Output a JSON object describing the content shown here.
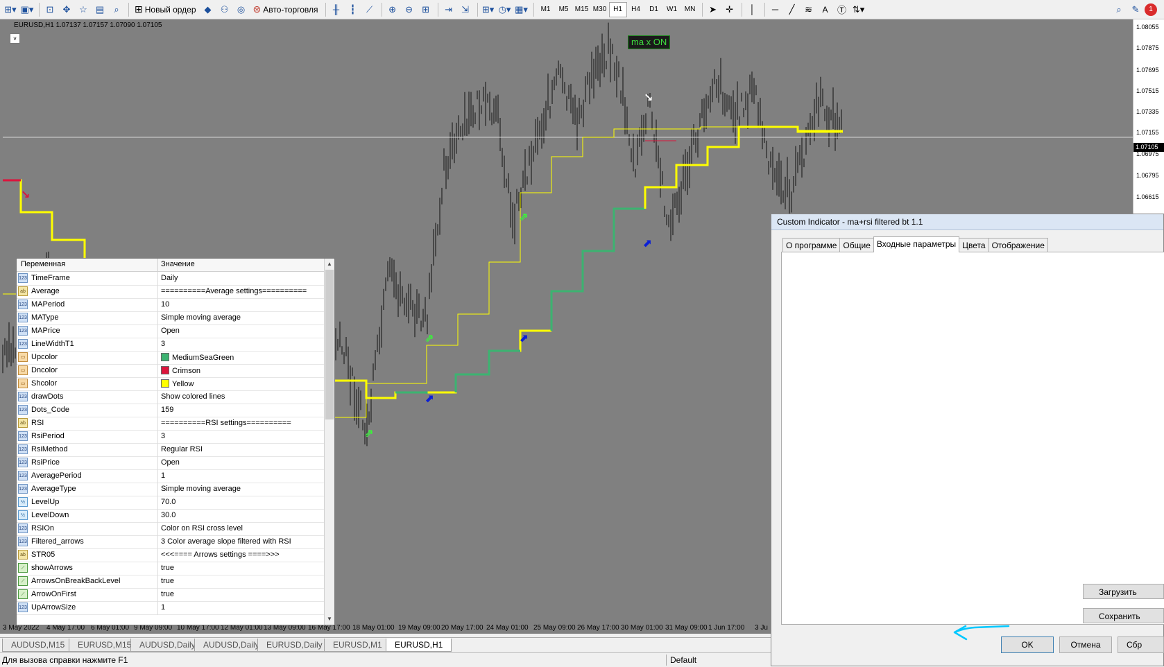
{
  "toolbar": {
    "new_order": "Новый ордер",
    "autotrading": "Авто-торговля",
    "timeframes": [
      "M1",
      "M5",
      "M15",
      "M30",
      "H1",
      "H4",
      "D1",
      "W1",
      "MN"
    ],
    "active_timeframe": "H1",
    "text_tool": "A",
    "notif_count": "1"
  },
  "chart": {
    "header": "EURUSD,H1  1.07137 1.07157 1.07090 1.07105",
    "menu_glyph": "v",
    "badge": "ma x ON",
    "price_ticks": [
      "1.08055",
      "1.07875",
      "1.07695",
      "1.07515",
      "1.07335",
      "1.07155",
      "1.06975",
      "1.06795",
      "1.06615"
    ],
    "last_price": "1.07105",
    "dates": [
      "3 May 2022",
      "4 May 17:00",
      "6 May 01:00",
      "9 May 09:00",
      "10 May 17:00",
      "12 May 01:00",
      "13 May 09:00",
      "16 May 17:00",
      "18 May 01:00",
      "19 May 09:00",
      "20 May 17:00",
      "24 May 01:00",
      "25 May 09:00",
      "26 May 17:00",
      "30 May 01:00",
      "31 May 09:00",
      "1 Jun 17:00",
      "3 Ju"
    ]
  },
  "chart_tabs": [
    "AUDUSD,M15",
    "EURUSD,M15",
    "AUDUSD,Daily",
    "AUDUSD,Daily",
    "EURUSD,Daily",
    "EURUSD,M1",
    "EURUSD,H1"
  ],
  "active_chart_tab": "EURUSD,H1",
  "status": {
    "help": "Для вызова справки нажмите F1",
    "profile": "Default"
  },
  "dialog": {
    "title": "Custom Indicator - ma+rsi filtered bt 1.1",
    "tabs": [
      "О программе",
      "Общие",
      "Входные параметры",
      "Цвета",
      "Отображение"
    ],
    "active_tab": "Входные параметры",
    "col_variable": "Переменная",
    "col_value": "Значение",
    "params": [
      {
        "icon": "123",
        "name": "TimeFrame",
        "value": "Daily"
      },
      {
        "icon": "ab",
        "name": "Average",
        "value": "==========Average settings=========="
      },
      {
        "icon": "123",
        "name": "MAPeriod",
        "value": "10"
      },
      {
        "icon": "123",
        "name": "MAType",
        "value": "Simple moving average"
      },
      {
        "icon": "123",
        "name": "MAPrice",
        "value": "Open"
      },
      {
        "icon": "123",
        "name": "LineWidthT1",
        "value": "3"
      },
      {
        "icon": "cl",
        "name": "Upcolor",
        "value": "MediumSeaGreen",
        "swatch": "#3cb371"
      },
      {
        "icon": "cl",
        "name": "Dncolor",
        "value": "Crimson",
        "swatch": "#dc143c"
      },
      {
        "icon": "cl",
        "name": "Shcolor",
        "value": "Yellow",
        "swatch": "#ffff00"
      },
      {
        "icon": "123",
        "name": "drawDots",
        "value": "Show colored lines"
      },
      {
        "icon": "123",
        "name": "Dots_Code",
        "value": "159"
      },
      {
        "icon": "ab",
        "name": "RSI",
        "value": "==========RSI settings=========="
      },
      {
        "icon": "123",
        "name": "RsiPeriod",
        "value": "3"
      },
      {
        "icon": "123",
        "name": "RsiMethod",
        "value": "Regular RSI"
      },
      {
        "icon": "123",
        "name": "RsiPrice",
        "value": "Open"
      },
      {
        "icon": "123",
        "name": "AveragePeriod",
        "value": "1"
      },
      {
        "icon": "123",
        "name": "AverageType",
        "value": "Simple moving average"
      },
      {
        "icon": "db",
        "name": "LevelUp",
        "value": "70.0"
      },
      {
        "icon": "db",
        "name": "LevelDown",
        "value": "30.0"
      },
      {
        "icon": "123",
        "name": "RSIOn",
        "value": "Color on RSI cross level"
      },
      {
        "icon": "123",
        "name": "Filtered_arrows",
        "value": "3 Color average slope filtered with RSI"
      },
      {
        "icon": "ab",
        "name": "STR05",
        "value": "<<<====  Arrows settings ====>>>"
      },
      {
        "icon": "bl",
        "name": "showArrows",
        "value": "true"
      },
      {
        "icon": "bl",
        "name": "ArrowsOnBreakBackLevel",
        "value": "true"
      },
      {
        "icon": "bl",
        "name": "ArrowOnFirst",
        "value": "true"
      },
      {
        "icon": "123",
        "name": "UpArrowSize",
        "value": "1"
      }
    ],
    "btn_load": "Загрузить",
    "btn_save": "Сохранить",
    "btn_ok": "OK",
    "btn_cancel": "Отмена",
    "btn_reset": "Сбр"
  },
  "colors": {
    "chart_bg": "#808080",
    "shcolor": "#ffff00",
    "dncolor": "#dc143c",
    "upcolor": "#3cb371",
    "badge_text": "#40e040",
    "annotation": "#00c8ff"
  }
}
